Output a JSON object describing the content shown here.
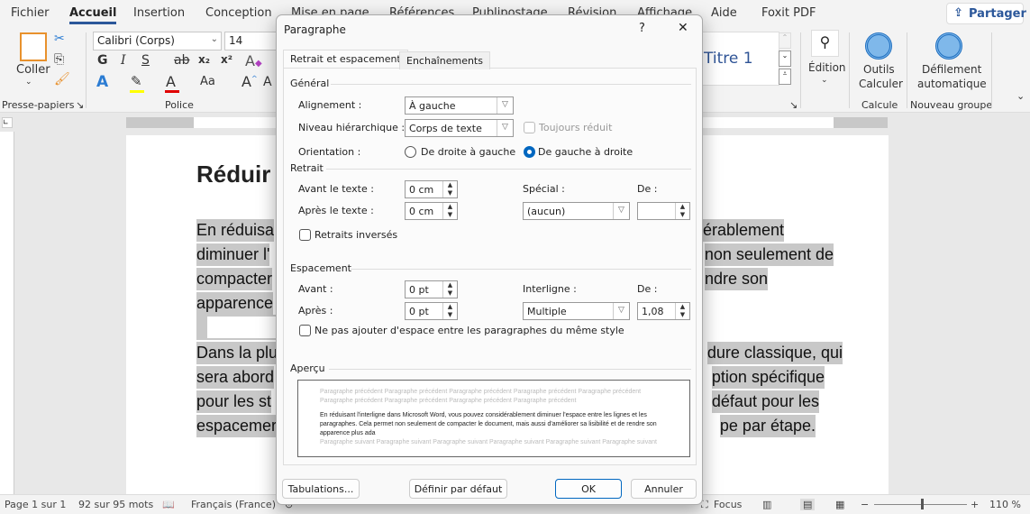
{
  "ribbon_tabs": [
    "Fichier",
    "Accueil",
    "Insertion",
    "Conception",
    "Mise en page",
    "Références",
    "Publipostage",
    "Révision",
    "Affichage",
    "Aide",
    "Foxit PDF"
  ],
  "active_tab": "Accueil",
  "share_label": "Partager",
  "clipboard": {
    "paste": "Coller",
    "group": "Presse-papiers"
  },
  "font": {
    "name": "Calibri (Corps)",
    "size": "14",
    "bold": "G",
    "italic": "I",
    "underline": "S",
    "strike": "ab",
    "sub": "x₂",
    "sup": "x²",
    "case": "Aa",
    "group": "Police"
  },
  "styles": {
    "visible": "Titre 1"
  },
  "edition": {
    "label": "Édition"
  },
  "calc": {
    "label1": "Outils",
    "label2": "Calculer",
    "group": "Calcule"
  },
  "scroll": {
    "label1": "Défilement",
    "label2": "automatique",
    "group": "Nouveau groupe"
  },
  "document": {
    "title": "Réduir",
    "para1": [
      {
        "left": "En réduisa",
        "right": "érablement"
      },
      {
        "left": "diminuer l'",
        "right": "non seulement de"
      },
      {
        "left": "compacter",
        "right": "ndre son"
      },
      {
        "left": "apparence",
        "right": ""
      }
    ],
    "para2": [
      {
        "left": "Dans la plu",
        "right": "dure classique, qui"
      },
      {
        "left": "sera abord",
        "right": "ption spécifique"
      },
      {
        "left": "pour les st",
        "right": "défaut pour les"
      },
      {
        "left": "espacemer",
        "right": "pe par étape."
      }
    ]
  },
  "status": {
    "page": "Page 1 sur 1",
    "words": "92 sur 95 mots",
    "language": "Français (France)",
    "focus": "Focus",
    "zoom": "110 %",
    "zoom_level_percent": 110
  },
  "dialog": {
    "title": "Paragraphe",
    "help": "?",
    "close": "✕",
    "tabs": [
      "Retrait et espacement",
      "Enchaînements"
    ],
    "general": {
      "heading": "Général",
      "alignment_label": "Alignement :",
      "alignment_value": "À gauche",
      "level_label": "Niveau hiérarchique :",
      "level_value": "Corps de texte",
      "collapsed_label": "Toujours réduit",
      "orientation_label": "Orientation :",
      "rtl": "De droite à gauche",
      "ltr": "De gauche à droite",
      "orientation_selected": "De gauche à droite"
    },
    "indent": {
      "heading": "Retrait",
      "before_label": "Avant le texte :",
      "before_value": "0 cm",
      "after_label": "Après le texte :",
      "after_value": "0 cm",
      "special_label": "Spécial :",
      "special_value": "(aucun)",
      "by_label": "De :",
      "by_value": "",
      "mirror_label": "Retraits inversés"
    },
    "spacing": {
      "heading": "Espacement",
      "before_label": "Avant :",
      "before_value": "0 pt",
      "after_label": "Après :",
      "after_value": "0 pt",
      "line_label": "Interligne :",
      "line_value": "Multiple",
      "at_label": "De :",
      "at_value": "1,08",
      "no_space_label": "Ne pas ajouter d'espace entre les paragraphes du même style"
    },
    "preview": {
      "heading": "Aperçu",
      "prev": "Paragraphe précédent Paragraphe précédent Paragraphe précédent Paragraphe précédent Paragraphe précédent Paragraphe précédent Paragraphe précédent Paragraphe précédent Paragraphe précédent",
      "current": "En réduisant l'interligne dans Microsoft Word, vous pouvez considérablement diminuer l'espace entre les lignes et les paragraphes. Cela permet non seulement de compacter le document, mais aussi d'améliorer sa lisibilité et de rendre son apparence plus ada",
      "next": "Paragraphe suivant Paragraphe suivant Paragraphe suivant Paragraphe suivant Paragraphe suivant Paragraphe suivant"
    },
    "buttons": {
      "tabs": "Tabulations...",
      "default": "Définir par défaut",
      "ok": "OK",
      "cancel": "Annuler"
    }
  }
}
